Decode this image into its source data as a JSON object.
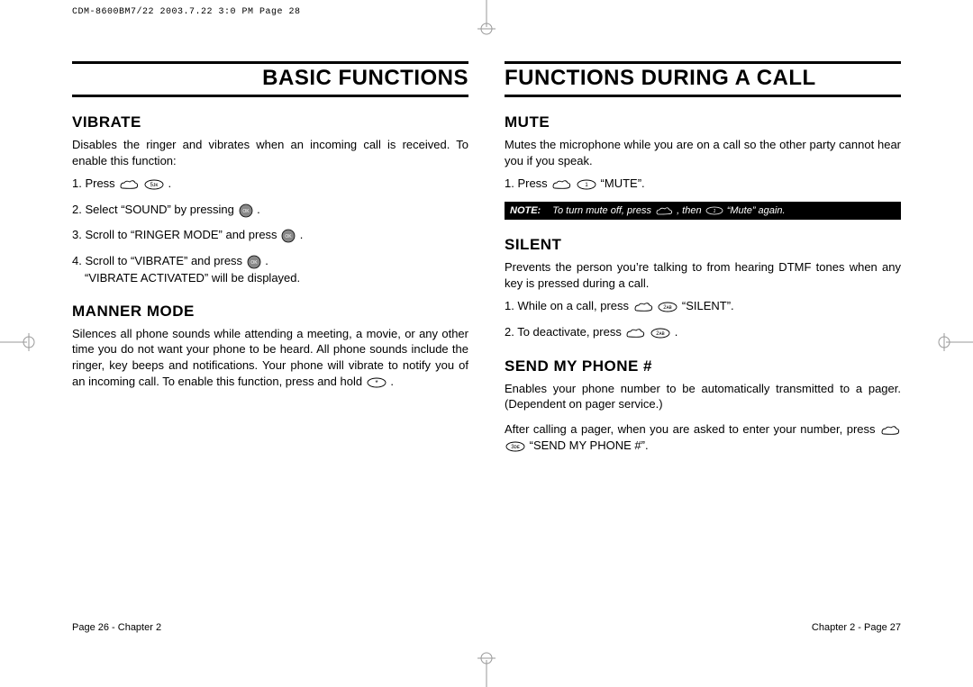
{
  "meta": {
    "header": "CDM-8600BM7/22  2003.7.22  3:0 PM  Page 28"
  },
  "left": {
    "title": "BASIC FUNCTIONS",
    "vibrate": {
      "heading": "VIBRATE",
      "intro": "Disables the ringer and vibrates when an incoming call is received. To enable this function:",
      "step1a": "1. Press ",
      "step1b": " .",
      "step2a": "2. Select “SOUND” by pressing ",
      "step2b": " .",
      "step3a": "3. Scroll to “RINGER MODE” and press ",
      "step3b": " .",
      "step4a": "4. Scroll to “VIBRATE” and press ",
      "step4b": " .",
      "step4c": "“VIBRATE ACTIVATED” will be displayed."
    },
    "manner": {
      "heading": "MANNER MODE",
      "body_a": "Silences all phone sounds while attending a meeting, a movie, or any other time you do not want your phone to be heard. All phone sounds include the ringer, key beeps and notifications. Your phone will vibrate to notify you of an incoming call. To enable this function, press and hold ",
      "body_b": " ."
    },
    "footer": "Page 26 - Chapter 2"
  },
  "right": {
    "title": "FUNCTIONS DURING A CALL",
    "mute": {
      "heading": "MUTE",
      "intro": "Mutes the microphone while you are on a call so the other party cannot hear you if you speak.",
      "step1a": "1. Press ",
      "step1b": " “MUTE”.",
      "note_label": "NOTE:",
      "note_a": "To turn mute off, press ",
      "note_b": " , then ",
      "note_c": " “Mute” again."
    },
    "silent": {
      "heading": "SILENT",
      "intro": "Prevents the person you’re talking to from hearing DTMF tones when any key is pressed during a call.",
      "step1a": "1. While on a call, press ",
      "step1b": " “SILENT”.",
      "step2a": "2. To deactivate, press ",
      "step2b": " ."
    },
    "send": {
      "heading": "SEND MY PHONE #",
      "intro": "Enables your phone number to be automatically transmitted to a pager. (Dependent on pager service.)",
      "body_a": "After calling a pager, when you are asked to enter your number, press ",
      "body_b": " “SEND MY PHONE #”."
    },
    "footer": "Chapter 2 - Page 27"
  },
  "keys": {
    "k1": "1",
    "k2": "2ᴀᴀ",
    "k3": "3ᴅᴇ",
    "k5": "5ᴊᴋ",
    "ok": "OK",
    "star": "*"
  }
}
